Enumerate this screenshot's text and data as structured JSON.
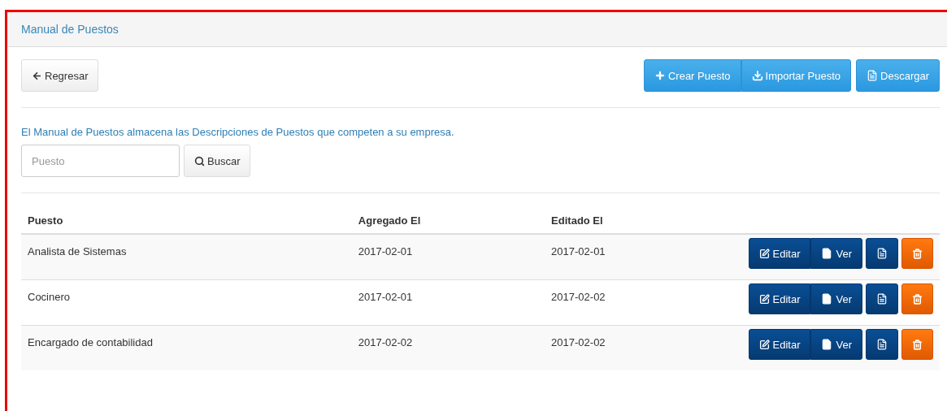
{
  "panel": {
    "title": "Manual de Puestos"
  },
  "back_button": "Regresar",
  "actions": [
    {
      "label": "Crear Puesto",
      "kind": "create"
    },
    {
      "label": "Importar Puesto",
      "kind": "import"
    },
    {
      "label": "Descargar",
      "kind": "download"
    }
  ],
  "description": "El Manual de Puestos almacena las Descripciones de Puestos que competen a su empresa.",
  "search": {
    "placeholder": "Puesto",
    "button": "Buscar"
  },
  "table": {
    "columns": [
      "Puesto",
      "Agregado El",
      "Editado El"
    ],
    "rows": [
      {
        "cells": [
          "Analista de Sistemas",
          "2017-02-01",
          "2017-02-01"
        ],
        "edit": "Editar",
        "view": "Ver"
      },
      {
        "cells": [
          "Cocinero",
          "2017-02-01",
          "2017-02-02"
        ],
        "edit": "Editar",
        "view": "Ver"
      },
      {
        "cells": [
          "Encargado de contabilidad",
          "2017-02-02",
          "2017-02-02"
        ],
        "edit": "Editar",
        "view": "Ver"
      }
    ]
  }
}
